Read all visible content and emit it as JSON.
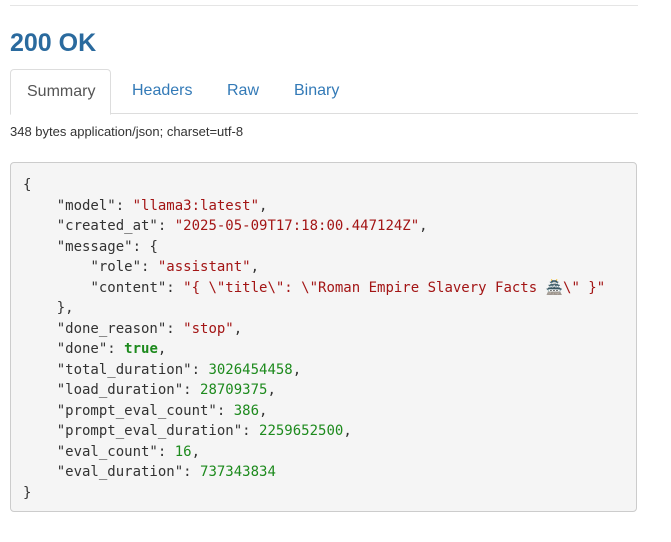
{
  "status": {
    "title": "200 OK"
  },
  "tabs": [
    {
      "label": "Summary",
      "active": true
    },
    {
      "label": "Headers",
      "active": false
    },
    {
      "label": "Raw",
      "active": false
    },
    {
      "label": "Binary",
      "active": false
    }
  ],
  "meta": {
    "description": "348 bytes application/json; charset=utf-8"
  },
  "json": {
    "open_brace": "{",
    "close_brace": "}",
    "model_key": "\"model\"",
    "model_val": "\"llama3:latest\"",
    "created_at_key": "\"created_at\"",
    "created_at_val": "\"2025-05-09T17:18:00.447124Z\"",
    "message_key": "\"message\"",
    "message_open": "{",
    "message_close": "},",
    "role_key": "\"role\"",
    "role_val": "\"assistant\"",
    "content_key": "\"content\"",
    "content_val": "\"{ \\\"title\\\": \\\"Roman Empire Slavery Facts 🏯\\\" }\"",
    "done_reason_key": "\"done_reason\"",
    "done_reason_val": "\"stop\"",
    "done_key": "\"done\"",
    "done_val": "true",
    "total_duration_key": "\"total_duration\"",
    "total_duration_val": "3026454458",
    "load_duration_key": "\"load_duration\"",
    "load_duration_val": "28709375",
    "prompt_eval_count_key": "\"prompt_eval_count\"",
    "prompt_eval_count_val": "386",
    "prompt_eval_duration_key": "\"prompt_eval_duration\"",
    "prompt_eval_duration_val": "2259652500",
    "eval_count_key": "\"eval_count\"",
    "eval_count_val": "16",
    "eval_duration_key": "\"eval_duration\"",
    "eval_duration_val": "737343834"
  },
  "colors": {
    "title": "#2a6a9e",
    "link": "#337ab7",
    "string": "#a31515",
    "number": "#1d8a1d"
  }
}
